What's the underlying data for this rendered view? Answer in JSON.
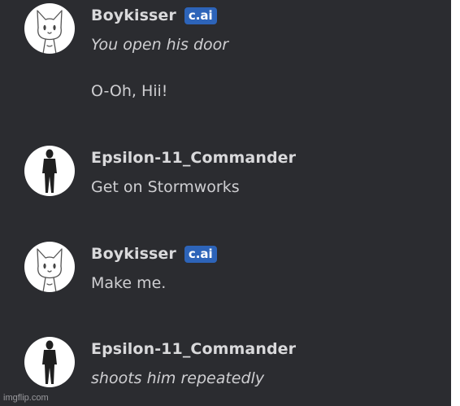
{
  "colors": {
    "chat_background": "#2b2c30",
    "name_text": "#d9d9db",
    "message_text": "#cfcfd2",
    "badge_background": "#2d64b9",
    "badge_text": "#ffffff",
    "outer_background": "#ffffff"
  },
  "messages": [
    {
      "sender": "Boykisser",
      "badge": "c.ai",
      "avatar": "cat-sketch-avatar",
      "lines": [
        "You open his door",
        "O-Oh, Hii!"
      ]
    },
    {
      "sender": "Epsilon-11_Commander",
      "avatar": "soldier-avatar",
      "lines": [
        "Get on Stormworks"
      ]
    },
    {
      "sender": "Boykisser",
      "badge": "c.ai",
      "avatar": "cat-sketch-avatar",
      "lines": [
        "Make me."
      ]
    },
    {
      "sender": "Epsilon-11_Commander",
      "avatar": "soldier-avatar",
      "lines": [
        "shoots him repeatedly"
      ]
    }
  ],
  "watermark": "imgflip.com"
}
